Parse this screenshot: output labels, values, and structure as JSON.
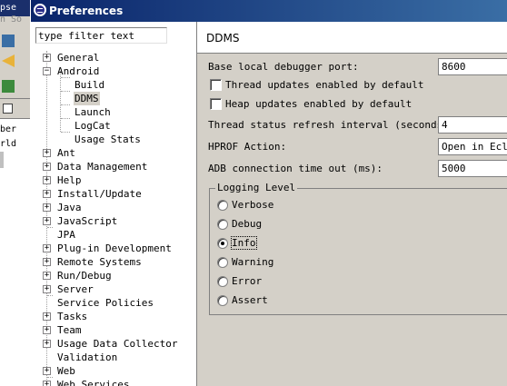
{
  "background_app": {
    "title_fragment": "pse",
    "menu_fragment": "n So",
    "rows": [
      "ber",
      "rld"
    ]
  },
  "window": {
    "title": "Preferences"
  },
  "filter": {
    "value": "type filter text"
  },
  "tree": {
    "general": "General",
    "android": "Android",
    "android_children": {
      "build": "Build",
      "ddms": "DDMS",
      "launch": "Launch",
      "logcat": "LogCat",
      "usage_stats": "Usage Stats"
    },
    "ant": "Ant",
    "data_management": "Data Management",
    "help": "Help",
    "install_update": "Install/Update",
    "java": "Java",
    "javascript": "JavaScript",
    "jpa": "JPA",
    "plugin_development": "Plug-in Development",
    "remote_systems": "Remote Systems",
    "run_debug": "Run/Debug",
    "server": "Server",
    "service_policies": "Service Policies",
    "tasks": "Tasks",
    "team": "Team",
    "usage_data_collector": "Usage Data Collector",
    "validation": "Validation",
    "web": "Web",
    "web_services": "Web Services",
    "expand_symbol": "+",
    "collapse_symbol": "−"
  },
  "page": {
    "title": "DDMS",
    "debugger_port": {
      "label": "Base local debugger port:",
      "value": "8600"
    },
    "thread_updates": {
      "label": "Thread updates enabled by default",
      "checked": false
    },
    "heap_updates": {
      "label": "Heap updates enabled by default",
      "checked": false
    },
    "thread_refresh": {
      "label": "Thread status refresh interval (seconds):",
      "value": "4"
    },
    "hprof_action": {
      "label": "HPROF Action:",
      "value": "Open in Ecli"
    },
    "adb_timeout": {
      "label": "ADB connection time out (ms):",
      "value": "5000"
    },
    "logging_level": {
      "title": "Logging Level",
      "options": [
        "Verbose",
        "Debug",
        "Info",
        "Warning",
        "Error",
        "Assert"
      ],
      "selected": "Info"
    }
  }
}
